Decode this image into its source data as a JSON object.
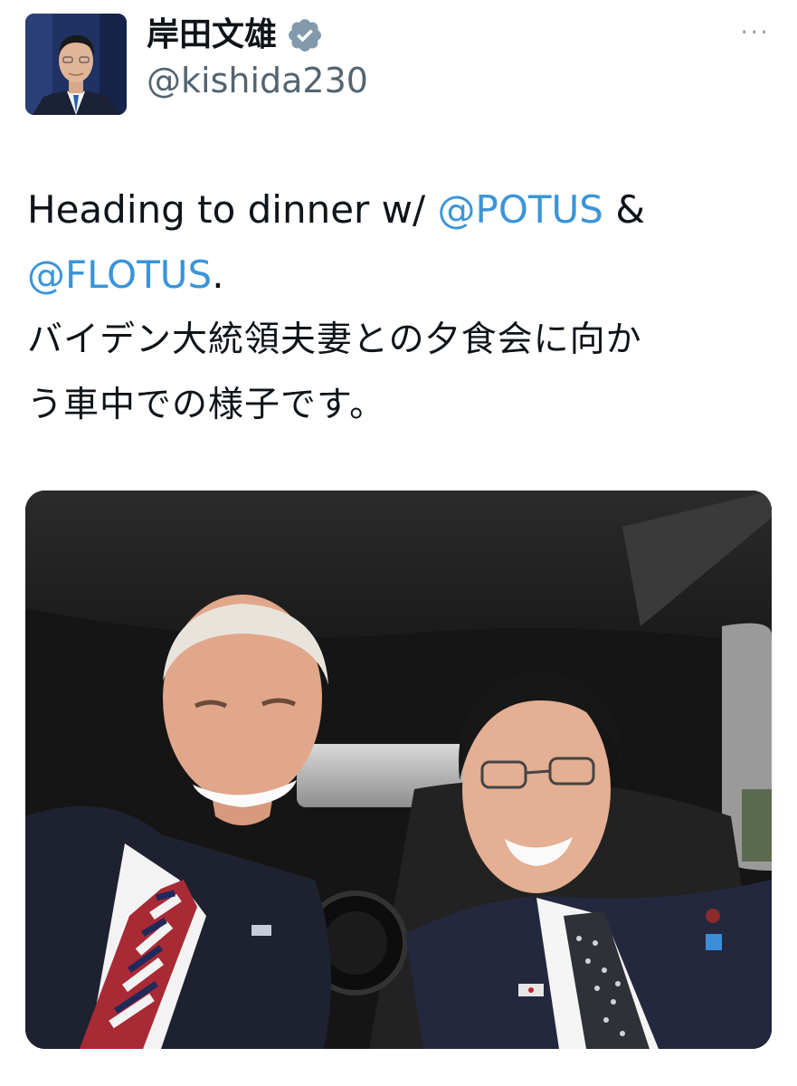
{
  "user": {
    "display_name": "岸田文雄",
    "handle": "@kishida230",
    "verified_icon": "verified-badge-icon",
    "avatar": "profile-photo"
  },
  "menu": {
    "more_label": "···"
  },
  "tweet": {
    "text_before": "Heading to dinner w/ ",
    "mention_1": "@POTUS",
    "text_middle": " &",
    "mention_2": "@FLOTUS",
    "text_after": ".",
    "line_ja_1": "バイデン大統領夫妻との夕食会に向か",
    "line_ja_2": "う車中での様子です。"
  },
  "media": {
    "type": "photo"
  },
  "colors": {
    "mention": "#3b94d9",
    "verified": "#829aab",
    "text": "#0f1419",
    "handle": "#536471"
  }
}
